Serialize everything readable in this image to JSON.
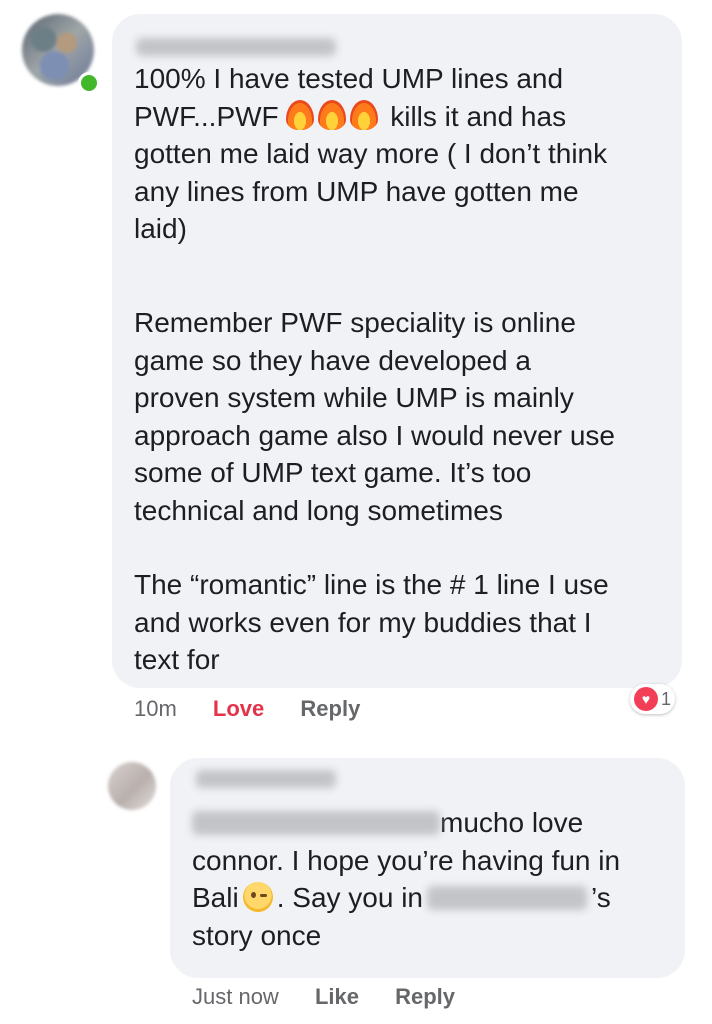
{
  "comment": {
    "lines_p1": [
      "100% I have tested UMP lines and",
      "PWF...PWF ",
      " kills it and has",
      "gotten me laid way more ( I don’t think",
      "any lines from UMP have gotten me",
      "laid)"
    ],
    "paragraph_2": "Remember PWF speciality is online\ngame so they have developed a\nproven system while UMP is mainly\napproach game also I would never use\nsome of UMP text game. It’s too\ntechnical and long sometimes",
    "paragraph_3": "The “romantic” line is the # 1 line I use\nand works even for my buddies that I\ntext for",
    "time": "10m",
    "love_label": "Love",
    "reply_label": "Reply",
    "reaction_count": "1",
    "reaction_icon": "heart-icon",
    "emoji": "fire-icon"
  },
  "reply": {
    "text_1": "mucho love",
    "text_2": "connor. I hope you’re having fun in",
    "text_3a": "Bali",
    "text_3b": ". Say you in",
    "text_3c": "’s",
    "text_4": "story once",
    "time": "Just now",
    "like_label": "Like",
    "reply_label": "Reply",
    "emoji": "wink-icon"
  },
  "colors": {
    "bubble": "#f0f2f5",
    "love": "#e4324a",
    "meta": "#65676b",
    "online": "#42b72a"
  }
}
